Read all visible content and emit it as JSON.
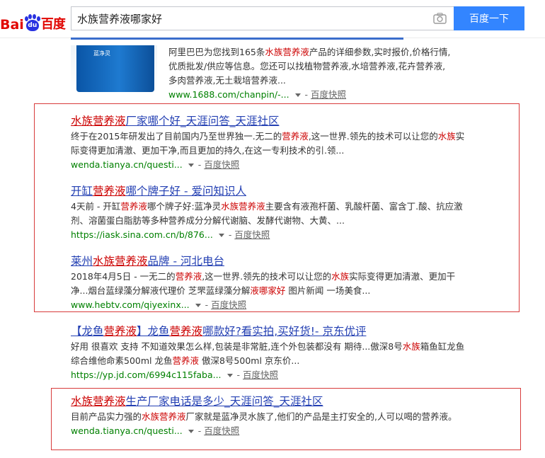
{
  "logo": {
    "bai": "Bai",
    "du": "du",
    "cn": "百度"
  },
  "search": {
    "query": "水族营养液哪家好",
    "button_label": "百度一下"
  },
  "first_result": {
    "desc_parts": [
      "阿里巴巴为您找到165条",
      "水族营养液",
      "产品的详细参数,实时报价,价格行情,优质批发/供应等信息。您还可以找植物营养液,水培营养液,花卉营养液,多肉营养液,无土栽培营养液..."
    ],
    "url": "www.1688.com/chanpin/-...",
    "snapshot": "百度快照",
    "thumb_label": "蓝净灵"
  },
  "results": [
    {
      "title_parts": [
        "水族营养液",
        "厂家哪个好_天涯问答_天涯社区"
      ],
      "desc_parts": [
        "终于在2015年研发出了目前国内乃至世界独一.无二的",
        "营养液",
        ",这一世界.领先的技术可以让您的",
        "水族",
        "实际变得更加清澈、更加干净,而且更加的持久,在这一专利技术的引.领..."
      ],
      "url": "wenda.tianya.cn/questi...",
      "snapshot": "百度快照"
    },
    {
      "title_parts": [
        "开缸",
        "营养液",
        "哪个牌子好 - 爱问知识人"
      ],
      "desc_parts": [
        "4天前 - 开缸",
        "营养液",
        "哪个牌子好:蓝净灵",
        "水族营养液",
        "主要含有液孢杆菌、乳酸杆菌、富含丁.酸、抗应激剂、溶菌蛋白脂肪等多种营养成分分解代谢脑、发酵代谢物、大黄、..."
      ],
      "url": "https://iask.sina.com.cn/b/876...",
      "snapshot": "百度快照"
    },
    {
      "title_parts": [
        "莱州",
        "水族营养液",
        "品牌 - 河北电台"
      ],
      "desc_parts": [
        "2018年4月5日 - 一无二的",
        "营养液",
        ",这一世界.领先的技术可以让您的",
        "水族",
        "实际变得更加清澈、更加干净...烟台蓝绿藻分解液代理价 芝罘蓝绿藻分解",
        "液哪家好",
        " 图片新闻 一场美食..."
      ],
      "url": "www.hebtv.com/qiyexinx...",
      "snapshot": "百度快照"
    },
    {
      "title_parts": [
        "【龙鱼",
        "营养液",
        "】龙鱼",
        "营养液",
        "哪款好?看实拍,买好货!- 京东优评"
      ],
      "desc_parts": [
        "好用 很喜欢 支持 不知道效果怎么样,包装是非常脏,连个外包装都没有 期待...傲深8号",
        "水族",
        "箱鱼缸龙鱼综合维他命素500ml 龙鱼",
        "营养液",
        " 傲深8号500ml 京东价..."
      ],
      "url": "https://yp.jd.com/6994c115faba...",
      "snapshot": "百度快照"
    },
    {
      "title_parts": [
        "水族营养液",
        "生产厂家电话是多少_天涯问答_天涯社区"
      ],
      "desc_parts": [
        "目前产品实力强的",
        "水族营养液",
        "厂家就是蓝净灵水族了,他们的产品是主打安全的,人可以喝的营养液。"
      ],
      "url": "wenda.tianya.cn/questi...",
      "snapshot": "百度快照"
    }
  ],
  "colors": {
    "link": "#2440b3",
    "highlight": "#c00000",
    "url": "#008000",
    "button": "#3385ff",
    "box": "#d83b3b"
  }
}
